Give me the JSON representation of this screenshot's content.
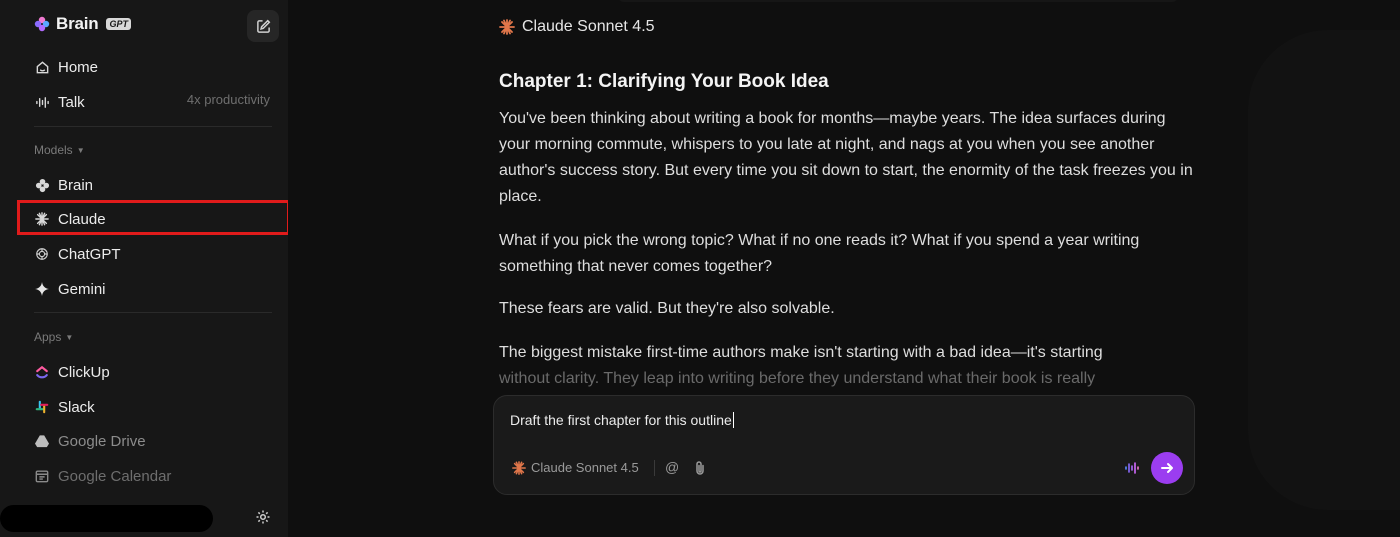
{
  "sidebar": {
    "brand": {
      "name": "Brain",
      "badge": "GPT"
    },
    "nav": [
      {
        "label": "Home",
        "icon": "home-icon"
      },
      {
        "label": "Talk",
        "icon": "waveform-icon",
        "meta": "4x productivity"
      }
    ],
    "models_label": "Models",
    "models": [
      {
        "label": "Brain",
        "icon": "brain-icon"
      },
      {
        "label": "Claude",
        "icon": "claude-icon"
      },
      {
        "label": "ChatGPT",
        "icon": "chatgpt-icon"
      },
      {
        "label": "Gemini",
        "icon": "gemini-icon"
      }
    ],
    "apps_label": "Apps",
    "apps": [
      {
        "label": "ClickUp",
        "icon": "clickup-icon"
      },
      {
        "label": "Slack",
        "icon": "slack-icon"
      },
      {
        "label": "Google Drive",
        "icon": "google-drive-icon"
      },
      {
        "label": "Google Calendar",
        "icon": "google-calendar-icon"
      }
    ]
  },
  "main": {
    "model_name": "Claude Sonnet 4.5",
    "chapter_title": "Chapter 1: Clarifying Your Book Idea",
    "paragraphs": [
      "You've been thinking about writing a book for months—maybe years. The idea surfaces during your morning commute, whispers to you late at night, and nags at you when you see another author's success story. But every time you sit down to start, the enormity of the task freezes you in place.",
      "What if you pick the wrong topic? What if no one reads it? What if you spend a year writing something that never comes together?",
      "These fears are valid. But they're also solvable.",
      "The biggest mistake first-time authors make isn't starting with a bad idea—it's starting"
    ],
    "fade_line": "without clarity. They leap into writing before they understand what their book is really"
  },
  "composer": {
    "input_value": "Draft the first chapter for this outline",
    "model_label": "Claude Sonnet 4.5",
    "mention_symbol": "@"
  },
  "colors": {
    "accent": "#9b3df0",
    "claude": "#e0764a",
    "highlight": "#e01b1b"
  }
}
